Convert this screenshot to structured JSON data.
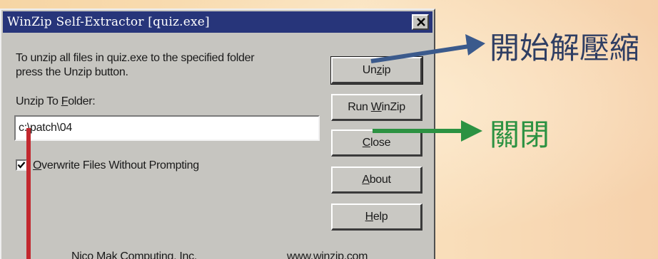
{
  "dialog": {
    "title": "WinZip Self-Extractor [quiz.exe]",
    "instructions_line1": "To unzip all files in quiz.exe to the specified folder",
    "instructions_line2": "press the Unzip button.",
    "folder_label_prefix": "Unzip To ",
    "folder_label_underlined": "F",
    "folder_label_suffix": "older:",
    "folder_value": "c:\\patch\\04",
    "overwrite_checked": true,
    "overwrite_label_underlined": "O",
    "overwrite_label_rest": "verwrite Files Without Prompting",
    "footer_company": "Nico Mak Computing, Inc.",
    "footer_url": "www.winzip.com",
    "close_icon": "close-x-icon"
  },
  "buttons": {
    "unzip": {
      "prefix": "Un",
      "underlined": "z",
      "suffix": "ip"
    },
    "run_winzip": {
      "prefix": "Run ",
      "underlined": "W",
      "suffix": "inZip"
    },
    "close": {
      "prefix": "",
      "underlined": "C",
      "suffix": "lose"
    },
    "about": {
      "prefix": "",
      "underlined": "A",
      "suffix": "bout"
    },
    "help": {
      "prefix": "",
      "underlined": "H",
      "suffix": "elp"
    }
  },
  "annotations": {
    "unzip_caption": "開始解壓縮",
    "close_caption": "關閉",
    "blue_arrow_color": "#3b5a8c",
    "green_arrow_color": "#2c9242",
    "red_line_color": "#c2282e"
  }
}
